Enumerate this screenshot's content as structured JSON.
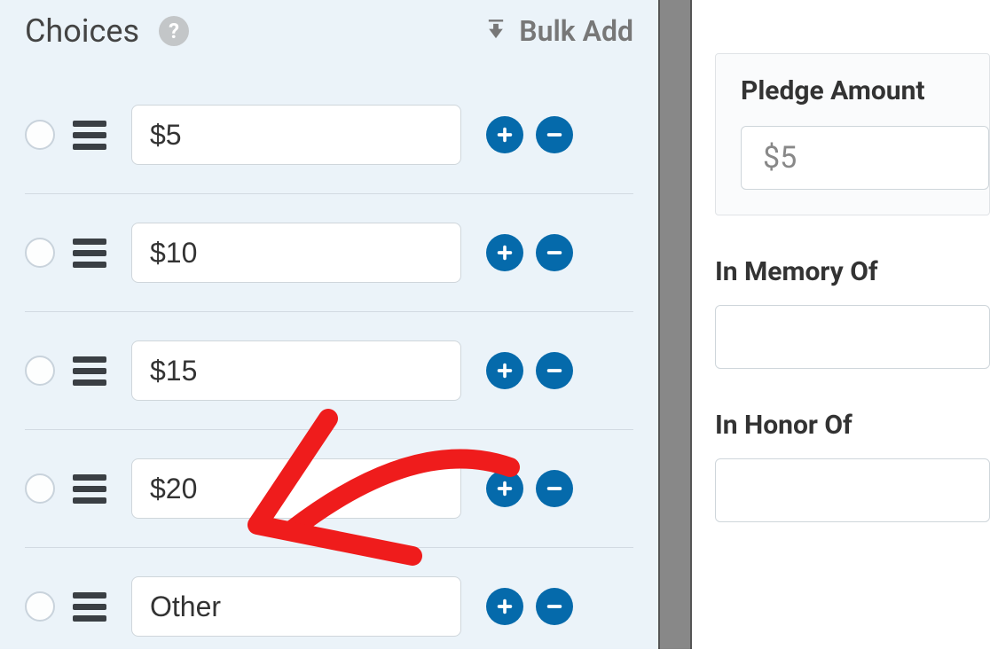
{
  "choices": {
    "title": "Choices",
    "help_icon": "help-icon",
    "bulk_add_label": "Bulk Add",
    "items": [
      {
        "value": "$5"
      },
      {
        "value": "$10"
      },
      {
        "value": "$15"
      },
      {
        "value": "$20"
      },
      {
        "value": "Other"
      }
    ]
  },
  "preview": {
    "pledge_label": "Pledge Amount",
    "pledge_value": "$5",
    "memory_label": "In Memory Of",
    "honor_label": "In Honor Of"
  },
  "colors": {
    "accent": "#056aab",
    "panel_bg": "#ebf3f9",
    "annotation": "#ef1c1c"
  }
}
